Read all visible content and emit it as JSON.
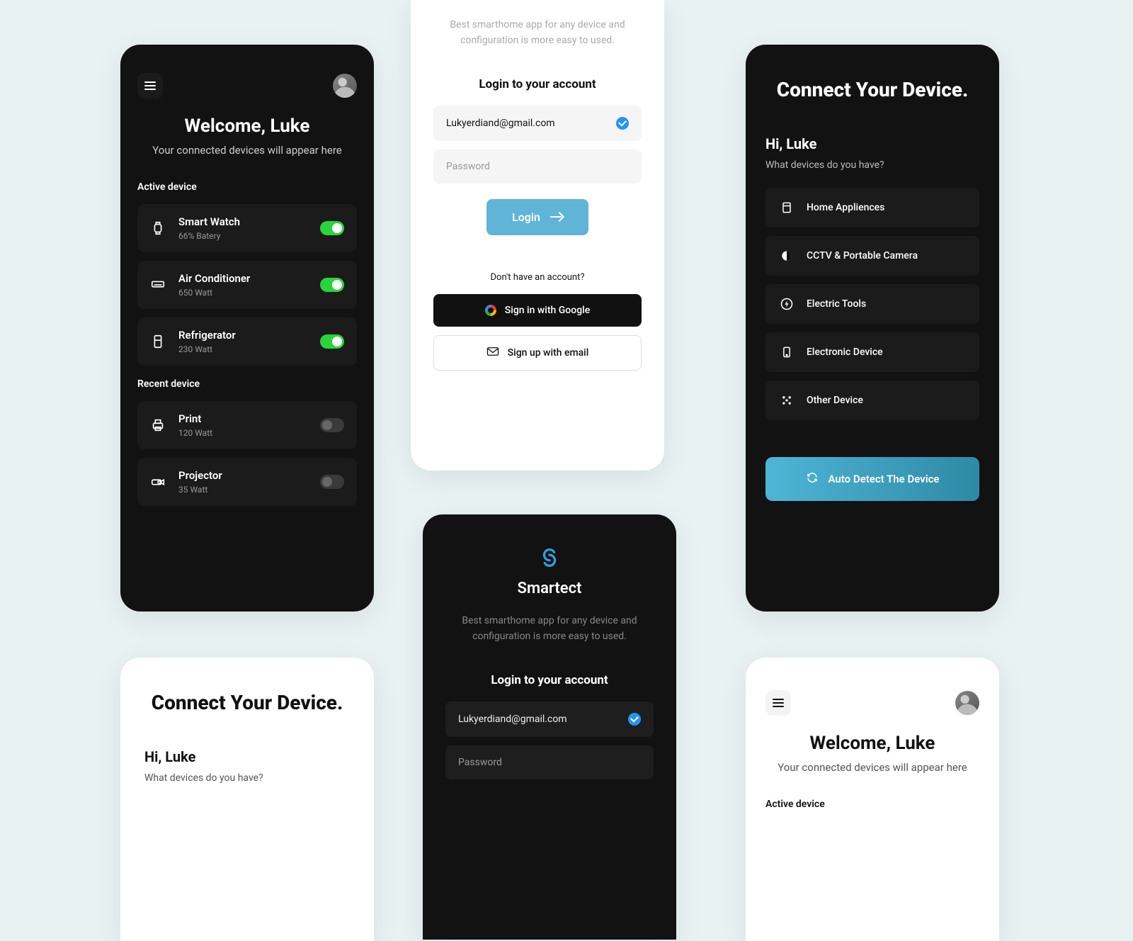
{
  "brand": "Smartect",
  "tagline": "Best smarthome app for any device and configuration is more easy to used.",
  "dashboard": {
    "welcome_title": "Welcome, Luke",
    "welcome_sub": "Your connected devices will appear here",
    "active_label": "Active device",
    "recent_label": "Recent device",
    "active": [
      {
        "name": "Smart Watch",
        "sub": "66% Batery",
        "on": true
      },
      {
        "name": "Air Conditioner",
        "sub": "650 Watt",
        "on": true
      },
      {
        "name": "Refrigerator",
        "sub": "230 Watt",
        "on": true
      }
    ],
    "recent": [
      {
        "name": "Print",
        "sub": "120 Watt",
        "on": false
      },
      {
        "name": "Projector",
        "sub": "35 Watt",
        "on": false
      }
    ]
  },
  "login": {
    "heading": "Login to your account",
    "email": "Lukyerdiand@gmail.com",
    "password_placeholder": "Password",
    "login_label": "Login",
    "no_account": "Don't have an account?",
    "google_label": "Sign in with Google",
    "email_label": "Sign up with email"
  },
  "connect": {
    "title": "Connect Your Device.",
    "hi": "Hi, Luke",
    "hi_sub": "What devices do you have?",
    "categories": [
      "Home Appliences",
      "CCTV & Portable Camera",
      "Electric Tools",
      "Electronic Device",
      "Other Device"
    ],
    "autodetect": "Auto Detect The Device"
  }
}
